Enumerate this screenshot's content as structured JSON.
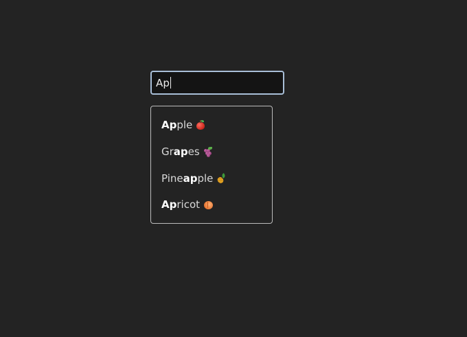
{
  "search": {
    "value": "Ap"
  },
  "suggestions": [
    {
      "parts": [
        {
          "text": "Ap",
          "match": true
        },
        {
          "text": "ple",
          "match": false
        }
      ],
      "icon": "red-apple-icon"
    },
    {
      "parts": [
        {
          "text": "Gr",
          "match": false
        },
        {
          "text": "ap",
          "match": true
        },
        {
          "text": "es",
          "match": false
        }
      ],
      "icon": "grapes-icon"
    },
    {
      "parts": [
        {
          "text": "Pine",
          "match": false
        },
        {
          "text": "ap",
          "match": true
        },
        {
          "text": "ple",
          "match": false
        }
      ],
      "icon": "pineapple-icon"
    },
    {
      "parts": [
        {
          "text": "Ap",
          "match": true
        },
        {
          "text": "ricot",
          "match": false
        }
      ],
      "icon": "peach-icon"
    }
  ],
  "colors": {
    "background": "#232323",
    "input_border": "#a9bfd8",
    "dropdown_border": "#bdbdbd",
    "text": "#d9d9d9",
    "highlight_text": "#ffffff"
  }
}
